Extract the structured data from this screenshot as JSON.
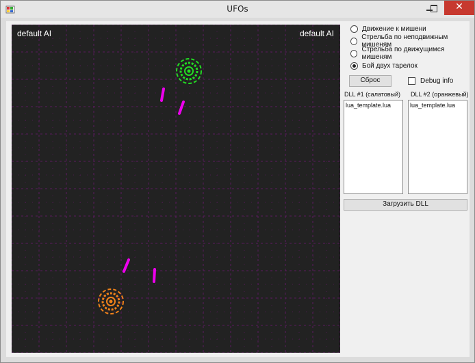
{
  "window": {
    "title": "UFOs"
  },
  "titlebar_icons": {
    "app": "app-icon",
    "minimize": "minimize-icon",
    "maximize": "maximize-icon",
    "close": "close-icon"
  },
  "close_glyph": "✕",
  "game": {
    "left_ai": "default AI",
    "right_ai": "default AI",
    "colors": {
      "background": "#222222",
      "grid": "#5a1a5e",
      "ufo1": "#22dd22",
      "ufo2": "#f0821a",
      "projectile": "#ee00ee"
    }
  },
  "modes": [
    {
      "label": "Движение к мишени",
      "selected": false
    },
    {
      "label": "Стрельба по неподвижным мишеням",
      "selected": false
    },
    {
      "label": "Стрельба по движущимся мишеням",
      "selected": false
    },
    {
      "label": "Бой двух тарелок",
      "selected": true
    }
  ],
  "reset_label": "Сброс",
  "debug": {
    "label": "Debug info",
    "checked": false
  },
  "dll1": {
    "label": "DLL #1 (салатовый)",
    "items": [
      "lua_template.lua"
    ]
  },
  "dll2": {
    "label": "DLL #2 (оранжевый)",
    "items": [
      "lua_template.lua"
    ]
  },
  "load_label": "Загрузить DLL"
}
